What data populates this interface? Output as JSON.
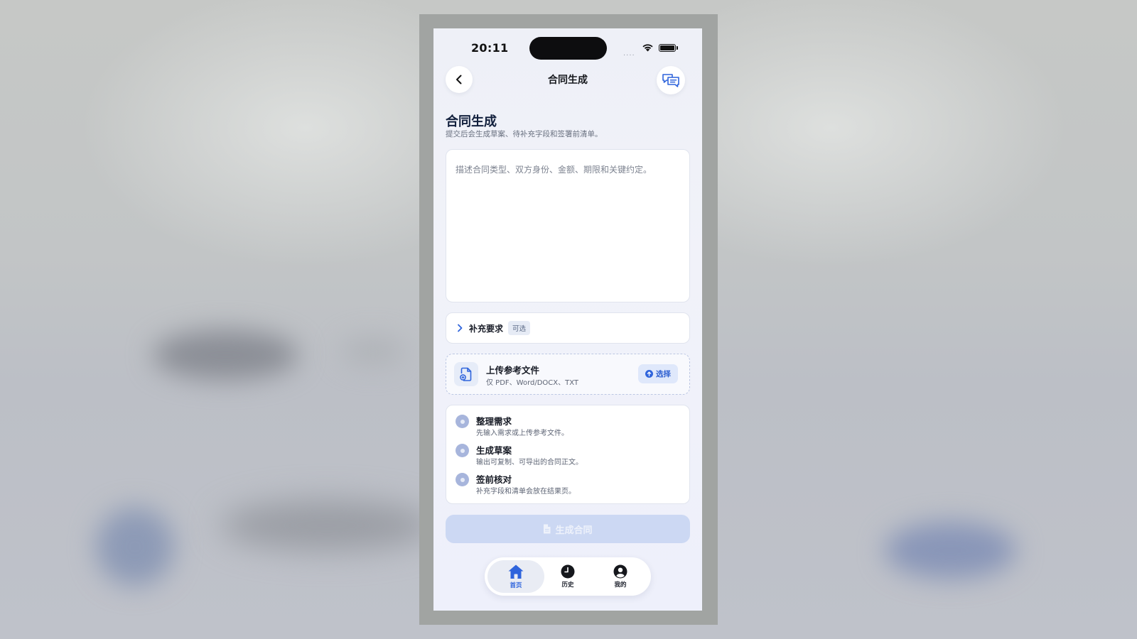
{
  "status_bar": {
    "time": "20:11",
    "signal": "....",
    "icons": [
      "wifi-icon",
      "battery-icon"
    ]
  },
  "nav": {
    "title": "合同生成",
    "back_icon": "chevron-left-icon",
    "chat_icon": "chat-bubbles-icon"
  },
  "header": {
    "title": "合同生成",
    "subtitle": "提交后会生成草案、待补充字段和签署前清单。"
  },
  "input": {
    "value": "",
    "placeholder": "描述合同类型、双方身份、金额、期限和关键约定。"
  },
  "supplement": {
    "label": "补充要求",
    "tag": "可选",
    "expanded": false,
    "icon": "chevron-right-icon"
  },
  "upload": {
    "title": "上传参考文件",
    "types": "仅 PDF、Word/DOCX、TXT",
    "button_label": "选择",
    "icon": "file-add-icon",
    "button_icon": "upload-arrow-icon"
  },
  "steps": [
    {
      "title": "整理需求",
      "desc": "先输入需求或上传参考文件。"
    },
    {
      "title": "生成草案",
      "desc": "输出可复制、可导出的合同正文。"
    },
    {
      "title": "签前核对",
      "desc": "补充字段和清单会放在结果页。"
    }
  ],
  "generate_button": {
    "label": "生成合同",
    "disabled": true,
    "icon": "document-icon"
  },
  "tab_bar": {
    "active": "home",
    "tabs": [
      {
        "id": "home",
        "label": "首页",
        "icon": "home-icon"
      },
      {
        "id": "history",
        "label": "历史",
        "icon": "clock-icon"
      },
      {
        "id": "profile",
        "label": "我的",
        "icon": "user-icon"
      }
    ]
  },
  "colors": {
    "accent": "#2f64dc",
    "disabled_button": "#ccd8f3",
    "step_dot": "#a7b5dc",
    "screen_bg": "#eef0f7"
  }
}
